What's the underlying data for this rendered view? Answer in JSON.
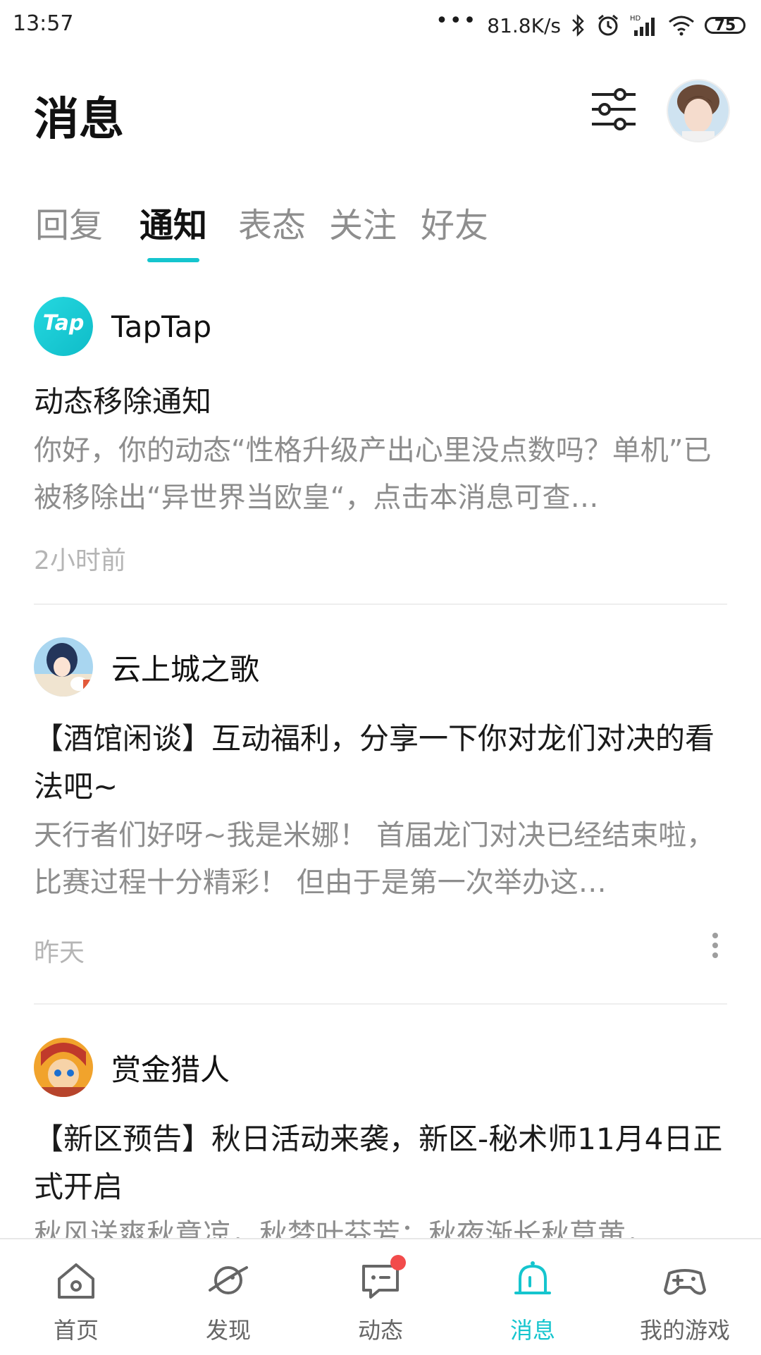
{
  "status_bar": {
    "time": "13:57",
    "dots": "•••",
    "network_speed": "81.8K/s",
    "battery": "75"
  },
  "header": {
    "title": "消息"
  },
  "tabs": [
    {
      "label": "回复"
    },
    {
      "label": "通知"
    },
    {
      "label": "表态"
    },
    {
      "label": "关注"
    },
    {
      "label": "好友"
    }
  ],
  "active_tab": "通知",
  "notifications": [
    {
      "sender": "TapTap",
      "avatar_text": "Tap",
      "title": "动态移除通知",
      "body": "你好，你的动态“性格升级产出心里没点数吗？单机”已被移除出“异世界当欧皇“，点击本消息可查…",
      "time": "2小时前"
    },
    {
      "sender": "云上城之歌",
      "title": "【酒馆闲谈】互动福利，分享一下你对龙们对决的看法吧~",
      "body": "天行者们好呀~我是米娜！  首届龙门对决已经结束啦，比赛过程十分精彩！  但由于是第一次举办这…",
      "time": "昨天"
    },
    {
      "sender": "赏金猎人",
      "title": "【新区预告】秋日活动来袭，新区-秘术师11月4日正式开启",
      "body": "秋风送爽秋意凉，秋梦叶芬芳；秋夜渐长秋草黄，"
    }
  ],
  "bottom_nav": [
    {
      "label": "首页",
      "icon": "home-icon"
    },
    {
      "label": "发现",
      "icon": "planet-icon"
    },
    {
      "label": "动态",
      "icon": "chat-icon"
    },
    {
      "label": "消息",
      "icon": "bell-icon"
    },
    {
      "label": "我的游戏",
      "icon": "gamepad-icon"
    }
  ],
  "colors": {
    "accent": "#15c5ce",
    "badge": "#f24b4b"
  }
}
